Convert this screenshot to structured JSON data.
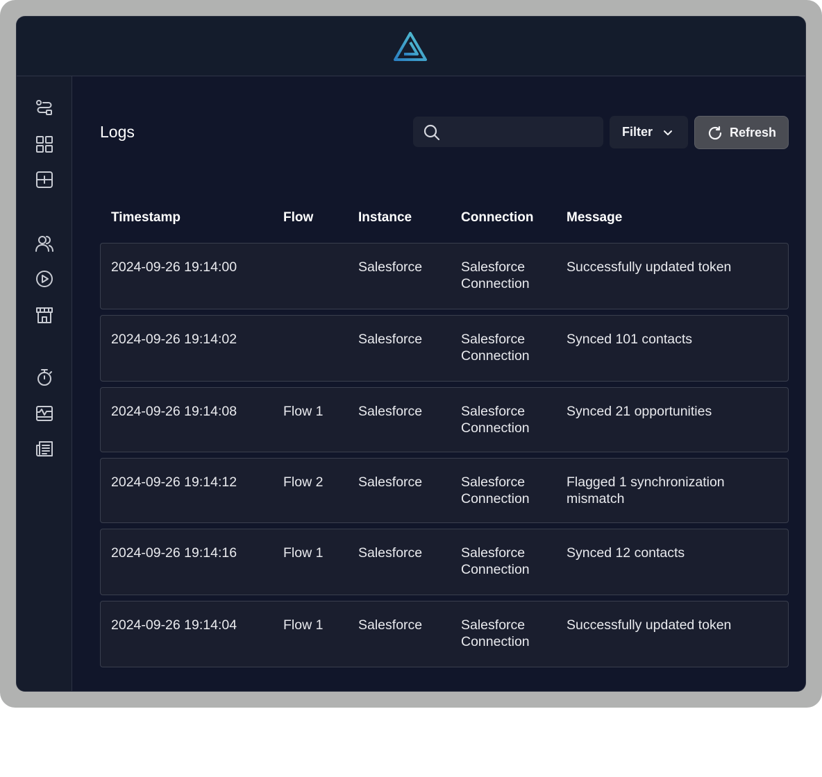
{
  "header": {
    "logo_icon": "triangle-logo-icon"
  },
  "sidebar": {
    "items": [
      {
        "icon": "flows-icon"
      },
      {
        "icon": "dashboard-grid-icon"
      },
      {
        "icon": "add-integration-icon"
      },
      {
        "icon": "customers-icon"
      },
      {
        "icon": "play-circle-icon"
      },
      {
        "icon": "marketplace-store-icon"
      },
      {
        "icon": "stopwatch-icon"
      },
      {
        "icon": "monitoring-chart-icon"
      },
      {
        "icon": "logs-newspaper-icon"
      }
    ]
  },
  "main": {
    "title": "Logs",
    "search": {
      "placeholder": "",
      "value": ""
    },
    "filter_label": "Filter",
    "refresh_label": "Refresh",
    "columns": [
      "Timestamp",
      "Flow",
      "Instance",
      "Connection",
      "Message"
    ],
    "rows": [
      {
        "timestamp": "2024-09-26 19:14:00",
        "flow": "",
        "instance": "Salesforce",
        "connection_line1": "Salesforce",
        "connection_line2": "Connection",
        "message_line1": "Successfully updated token",
        "message_line2": ""
      },
      {
        "timestamp": "2024-09-26 19:14:02",
        "flow": "",
        "instance": "Salesforce",
        "connection_line1": "Salesforce",
        "connection_line2": "Connection",
        "message_line1": "Synced 101 contacts",
        "message_line2": ""
      },
      {
        "timestamp": "2024-09-26 19:14:08",
        "flow": "Flow 1",
        "instance": "Salesforce",
        "connection_line1": "Salesforce",
        "connection_line2": "Connection",
        "message_line1": "Synced 21 opportunities",
        "message_line2": ""
      },
      {
        "timestamp": "2024-09-26 19:14:12",
        "flow": "Flow 2",
        "instance": "Salesforce",
        "connection_line1": "Salesforce",
        "connection_line2": "Connection",
        "message_line1": "Flagged 1 synchronization",
        "message_line2": "mismatch"
      },
      {
        "timestamp": "2024-09-26 19:14:16",
        "flow": "Flow 1",
        "instance": "Salesforce",
        "connection_line1": "Salesforce",
        "connection_line2": "Connection",
        "message_line1": "Synced 12 contacts",
        "message_line2": ""
      },
      {
        "timestamp": "2024-09-26 19:14:04",
        "flow": "Flow 1",
        "instance": "Salesforce",
        "connection_line1": "Salesforce",
        "connection_line2": "Connection",
        "message_line1": "Successfully updated token",
        "message_line2": ""
      }
    ]
  },
  "colors": {
    "background": "#11162a",
    "topbar": "#141c2c",
    "row_background": "#1a1e2e",
    "row_border": "#3a3f4e",
    "refresh_button": "#4a4c53",
    "logo_gradient_start": "#2b7fc0",
    "logo_gradient_end": "#58c7d3"
  }
}
